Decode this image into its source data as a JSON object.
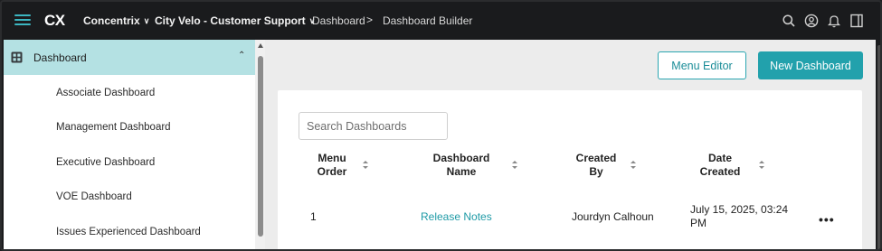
{
  "topbar": {
    "logo": "CX",
    "org_label": "Concentrix",
    "project_label": "City Velo - Customer Support",
    "breadcrumb": [
      "Dashboard",
      "Dashboard Builder"
    ],
    "breadcrumb_sep": ">",
    "icons": [
      "search-icon",
      "user-icon",
      "bell-icon",
      "panel-icon"
    ]
  },
  "sidebar": {
    "section_label": "Dashboard",
    "items": [
      {
        "label": "Associate Dashboard"
      },
      {
        "label": "Management Dashboard"
      },
      {
        "label": "Executive Dashboard"
      },
      {
        "label": "VOE Dashboard"
      },
      {
        "label": "Issues Experienced Dashboard"
      }
    ]
  },
  "actions": {
    "menu_editor": "Menu Editor",
    "new_dashboard": "New Dashboard"
  },
  "search": {
    "placeholder": "Search Dashboards",
    "value": ""
  },
  "table": {
    "columns": [
      {
        "label_line1": "Menu",
        "label_line2": "Order"
      },
      {
        "label_line1": "Dashboard",
        "label_line2": "Name"
      },
      {
        "label_line1": "Created",
        "label_line2": "By"
      },
      {
        "label_line1": "Date",
        "label_line2": "Created"
      }
    ],
    "rows": [
      {
        "menu_order": "1",
        "name": "Release Notes",
        "created_by": "Jourdyn Calhoun",
        "date_created": "July 15, 2025, 03:24 PM",
        "more": "•••"
      }
    ]
  },
  "colors": {
    "accent": "#22a1ac",
    "sidebar_active": "#b4e1e3",
    "topbar_bg": "#1a1b1d"
  }
}
